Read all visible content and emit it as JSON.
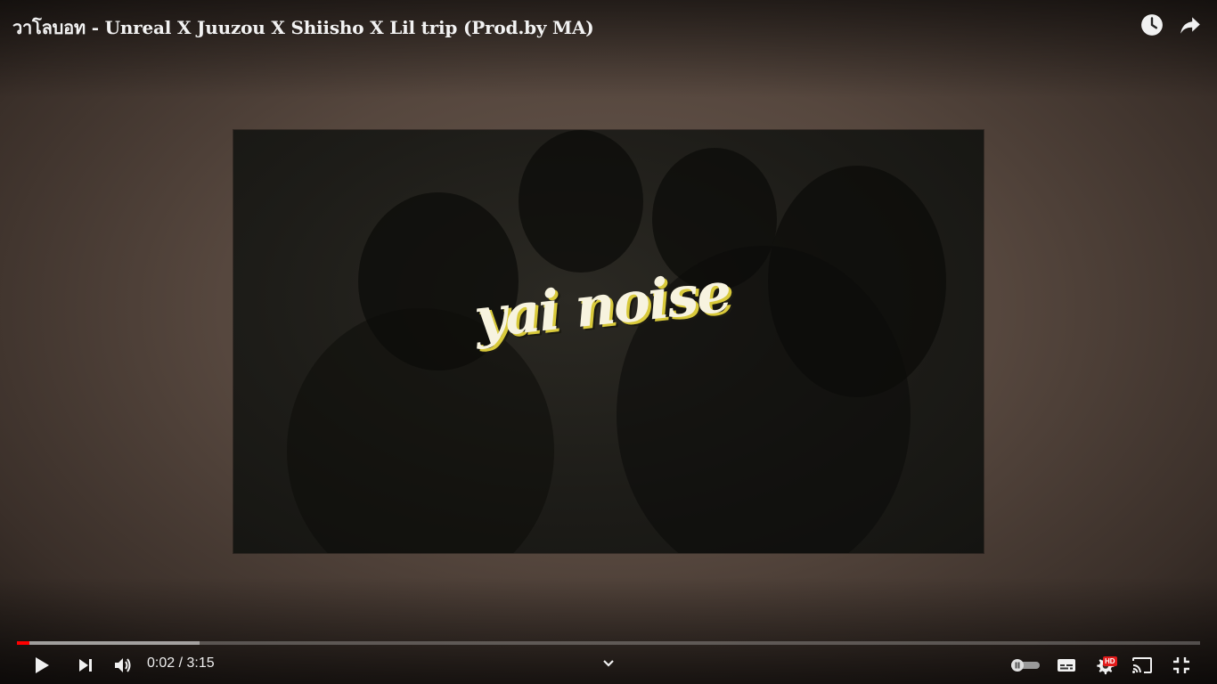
{
  "video": {
    "title": "วาโลบอท - Unreal X Juuzou X Shiisho X Lil trip (Prod.by MA)",
    "overlay_text": "yai noise"
  },
  "top_actions": {
    "watch_later_icon": "clock-icon",
    "share_icon": "share-arrow-icon"
  },
  "controls": {
    "play_icon": "play-icon",
    "next_icon": "next-track-icon",
    "volume_icon": "volume-icon",
    "time_display": "0:02 / 3:15",
    "chevron_icon": "chevron-down-icon",
    "autoplay_icon": "autoplay-toggle-icon",
    "subtitles_icon": "subtitles-icon",
    "settings_icon": "gear-icon",
    "hd_badge": "HD",
    "cast_icon": "cast-icon",
    "exit_fullscreen_icon": "exit-fullscreen-icon"
  },
  "progress": {
    "played_fraction": 0.0103,
    "buffered_fraction": 0.154
  },
  "colors": {
    "progress_played": "#ff0000",
    "hd_badge_bg": "#e21b1b",
    "text": "#f2f2f2"
  }
}
